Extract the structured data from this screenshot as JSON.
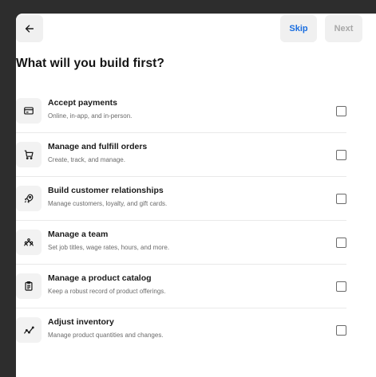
{
  "header": {
    "back_icon": "arrow-left-icon",
    "skip_label": "Skip",
    "next_label": "Next"
  },
  "page": {
    "title": "What will you build first?"
  },
  "colors": {
    "accent": "#1a6ee0",
    "disabled_text": "#a8a8a8",
    "button_bg": "#f0f0f0",
    "divider": "#e9e9e9"
  },
  "options": [
    {
      "icon": "credit-card-icon",
      "title": "Accept payments",
      "subtitle": "Online, in-app, and in-person.",
      "checked": false
    },
    {
      "icon": "shopping-cart-icon",
      "title": "Manage and fulfill orders",
      "subtitle": "Create, track, and manage.",
      "checked": false
    },
    {
      "icon": "rocket-icon",
      "title": "Build customer relationships",
      "subtitle": "Manage customers, loyalty, and gift cards.",
      "checked": false
    },
    {
      "icon": "team-icon",
      "title": "Manage a team",
      "subtitle": "Set job titles, wage rates, hours, and more.",
      "checked": false
    },
    {
      "icon": "clipboard-icon",
      "title": "Manage a product catalog",
      "subtitle": "Keep a robust record of product offerings.",
      "checked": false
    },
    {
      "icon": "trend-line-icon",
      "title": "Adjust inventory",
      "subtitle": "Manage product quantities and changes.",
      "checked": false
    }
  ]
}
